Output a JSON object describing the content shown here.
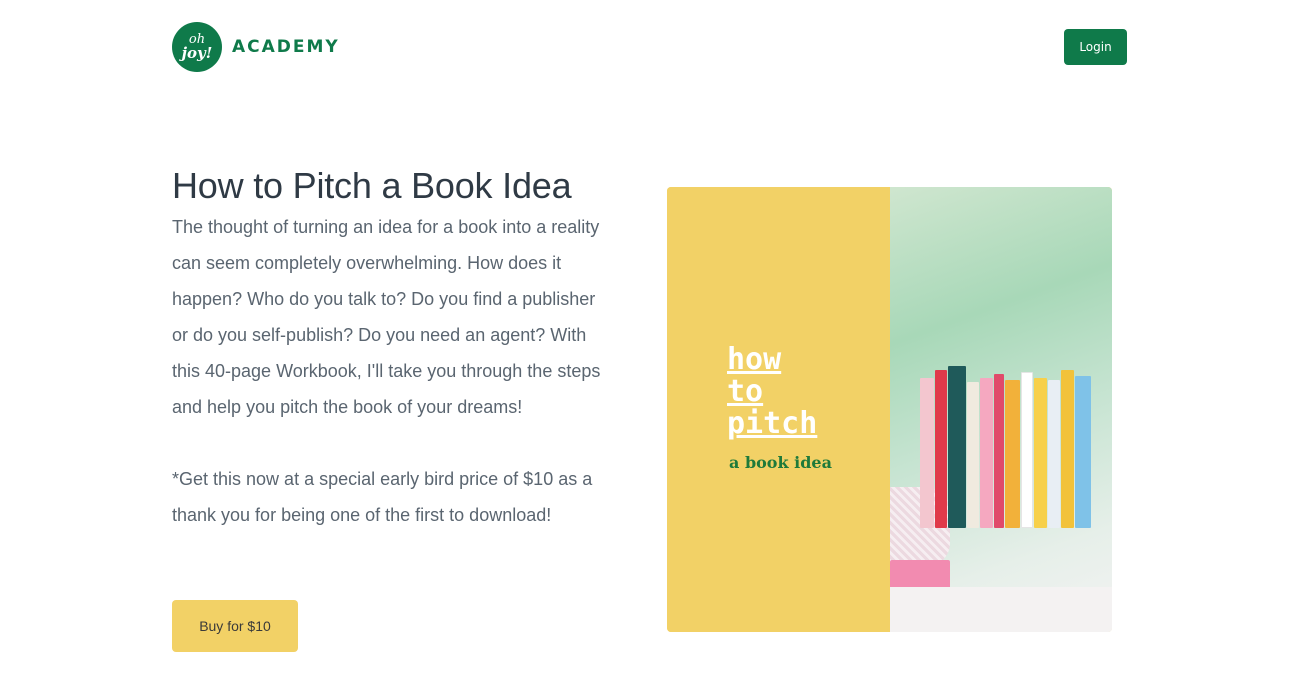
{
  "header": {
    "logo_line1": "oh",
    "logo_line2": "joy!",
    "logo_text": "ACADEMY",
    "login_label": "Login"
  },
  "main": {
    "title": "How to Pitch a Book Idea",
    "description": "The thought of turning an idea for a book into a reality can seem completely overwhelming. How does it happen? Who do you talk to? Do you find a publisher or do you self-publish? Do you need an agent? With this 40-page Workbook, I'll take you through the steps and help you pitch the book of your dreams!",
    "note": "*Get this now at a special early bird price of $10 as a thank you for being one of the first to download!",
    "buy_label": "Buy for $10"
  },
  "hero": {
    "title_lines": [
      "how",
      "to",
      "pitch"
    ],
    "subtitle": "a book idea"
  },
  "colors": {
    "brand_green": "#0f7a4a",
    "accent_yellow": "#f2d166"
  }
}
